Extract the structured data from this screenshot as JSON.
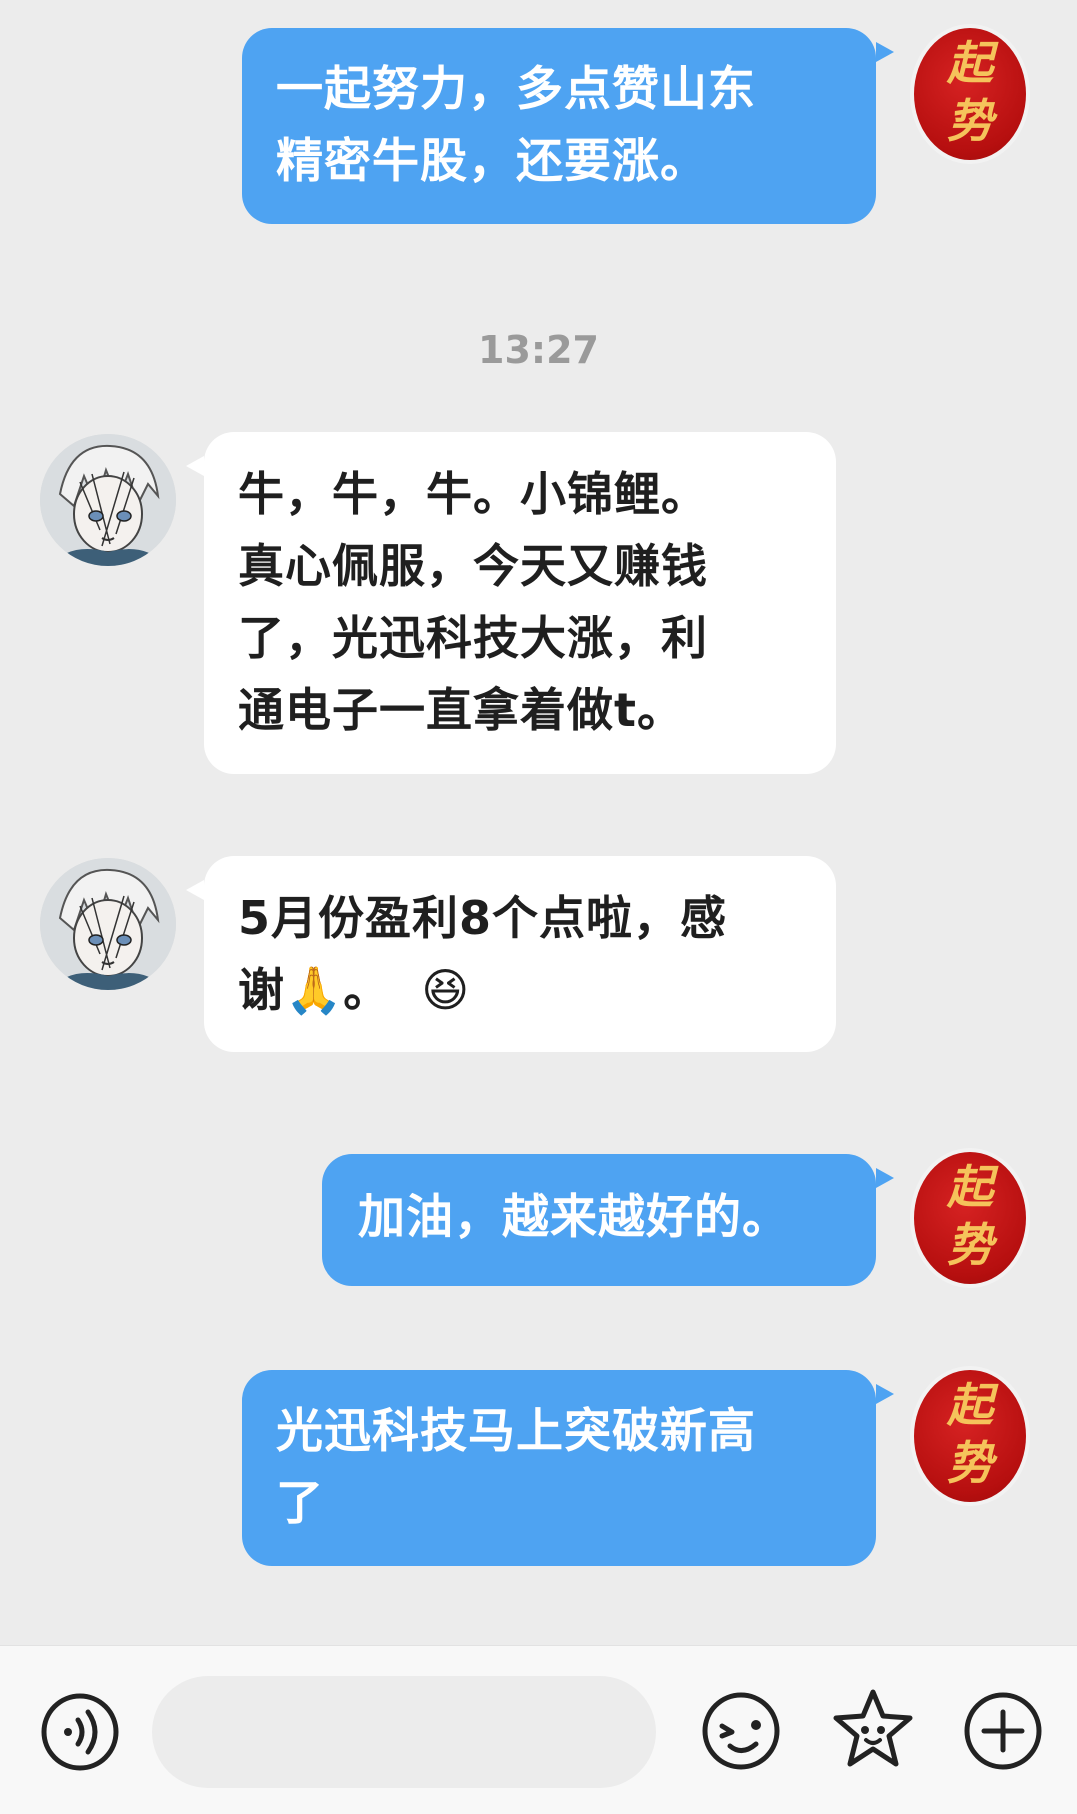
{
  "messages": [
    {
      "id": "m1",
      "direction": "outgoing",
      "text_lines": [
        "一起努力，多点赞山东",
        "精密牛股，还要涨。"
      ]
    },
    {
      "id": "m2",
      "direction": "incoming",
      "text_lines": [
        "牛，牛，牛。小锦鲤。",
        "真心佩服，今天又赚钱",
        "了，光迅科技大涨，利",
        "通电子一直拿着做t。"
      ]
    },
    {
      "id": "m3",
      "direction": "incoming",
      "text_lines": [
        "5月份盈利8个点啦，感",
        "谢🙏。"
      ],
      "emoji": "😆"
    },
    {
      "id": "m4",
      "direction": "outgoing",
      "text_lines": [
        "加油，越来越好的。"
      ]
    },
    {
      "id": "m5",
      "direction": "outgoing",
      "text_lines": [
        "光迅科技马上突破新高",
        "了"
      ]
    }
  ],
  "timestamp": "13:27",
  "self_avatar": {
    "line1": "起",
    "line2": "势"
  },
  "colors": {
    "background": "#ececec",
    "outgoing_bubble": "#4ea3f2",
    "incoming_bubble": "#ffffff",
    "avatar_red": "#c41515",
    "avatar_gold": "#f5c35b"
  },
  "input_bar": {
    "voice_icon": "voice-wave-icon",
    "emoji_icon": "smiley-icon",
    "sticker_icon": "star-face-icon",
    "more_icon": "plus-circle-icon"
  }
}
